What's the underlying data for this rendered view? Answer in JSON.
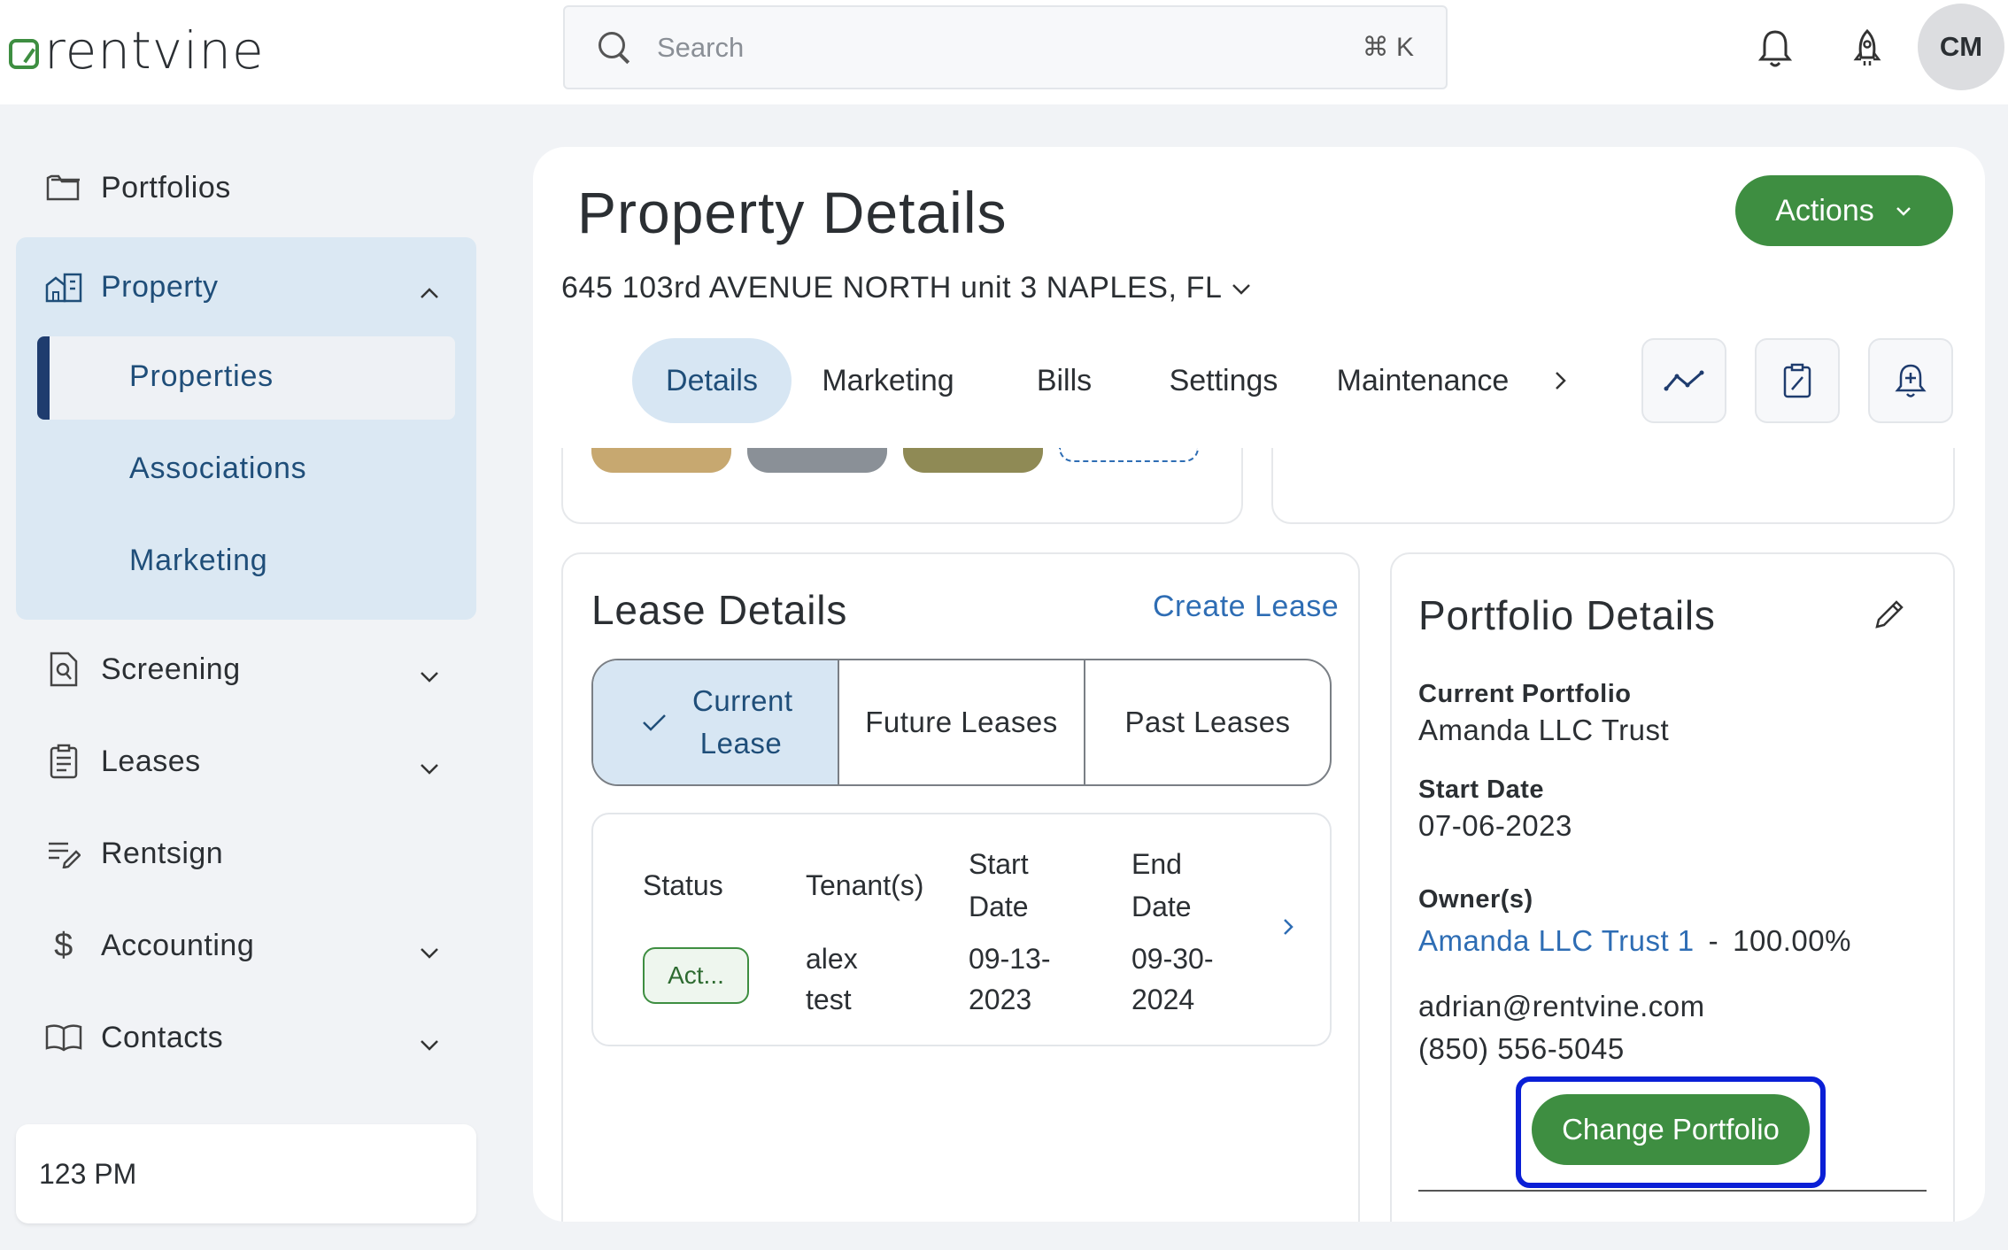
{
  "topbar": {
    "brand": "rentvine",
    "search_placeholder": "Search",
    "search_shortcut": "⌘ K",
    "avatar_initials": "CM"
  },
  "sidebar": {
    "items": [
      {
        "label": "Portfolios"
      },
      {
        "label": "Property"
      },
      {
        "label": "Screening"
      },
      {
        "label": "Leases"
      },
      {
        "label": "Rentsign"
      },
      {
        "label": "Accounting"
      },
      {
        "label": "Contacts"
      }
    ],
    "property_sub": [
      "Properties",
      "Associations",
      "Marketing"
    ],
    "status_text": "123 PM"
  },
  "header": {
    "title": "Property Details",
    "address": "645 103rd AVENUE NORTH unit 3 NAPLES, FL",
    "actions_label": "Actions"
  },
  "tabs": [
    {
      "label": "Details",
      "active": true
    },
    {
      "label": "Marketing"
    },
    {
      "label": "Bills"
    },
    {
      "label": "Settings"
    },
    {
      "label": "Maintenance"
    }
  ],
  "lease": {
    "title": "Lease Details",
    "create_link": "Create Lease",
    "segments": [
      "Current Lease",
      "Future Leases",
      "Past Leases"
    ],
    "columns": [
      "Status",
      "Tenant(s)",
      "Start Date",
      "End Date"
    ],
    "row": {
      "status": "Act...",
      "tenant": "alex test",
      "start": "09-13-2023",
      "end": "09-30-2024"
    }
  },
  "portfolio": {
    "title": "Portfolio Details",
    "current_label": "Current Portfolio",
    "current_value": "Amanda LLC Trust",
    "start_label": "Start Date",
    "start_value": "07-06-2023",
    "owners_label": "Owner(s)",
    "owner_name": "Amanda LLC Trust 1",
    "owner_sep": "-",
    "owner_pct": "100.00%",
    "email": "adrian@rentvine.com",
    "phone": "(850) 556-5045",
    "change_btn": "Change Portfolio"
  },
  "colors": {
    "accent_green": "#3e8e41",
    "link_blue": "#2e6db4",
    "active_bg": "#d7e6f3",
    "highlight": "#0a1fd6"
  }
}
